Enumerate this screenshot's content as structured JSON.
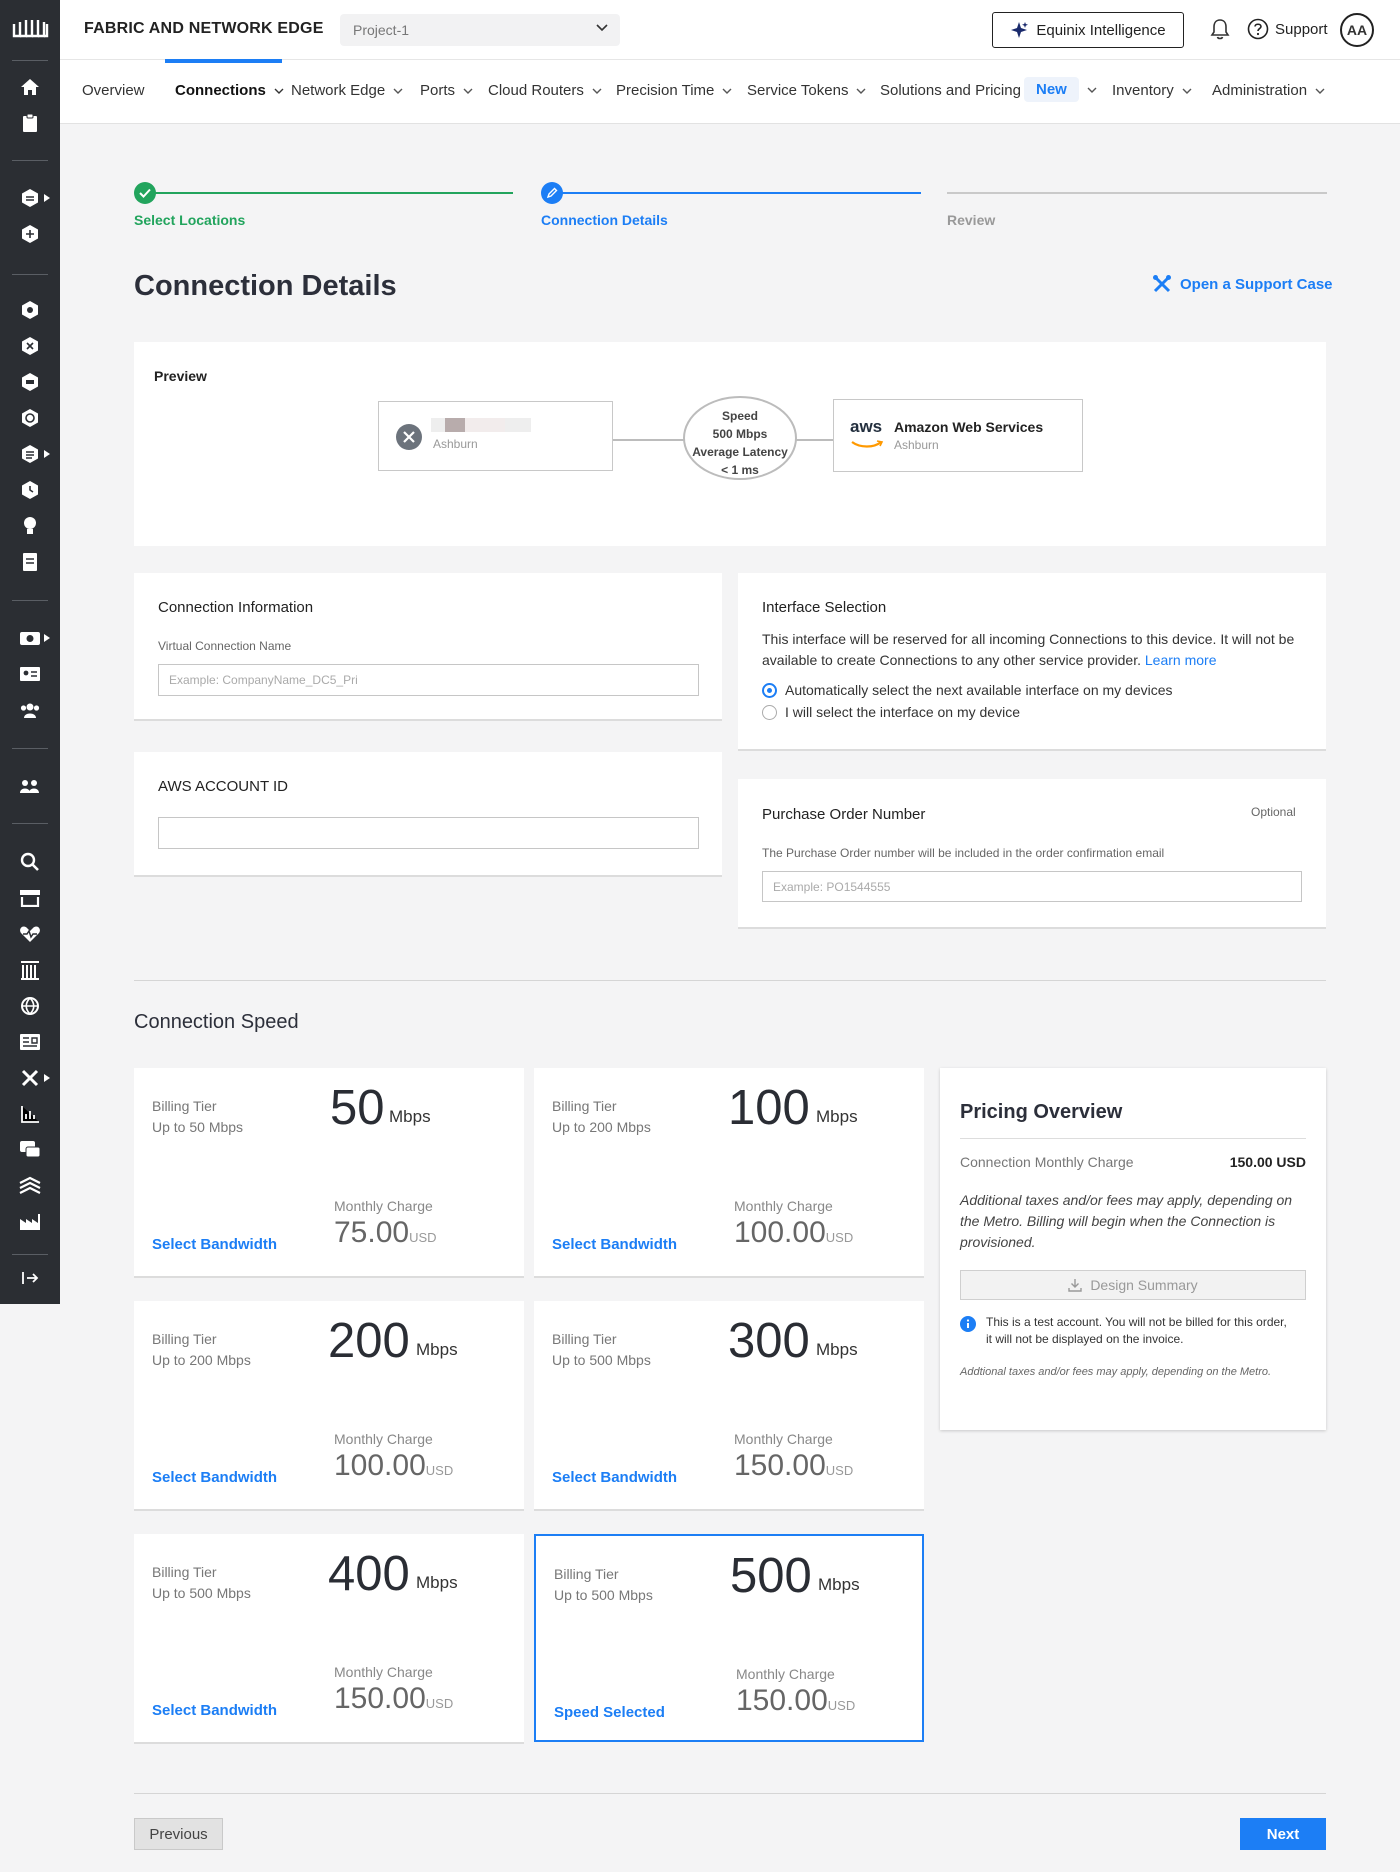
{
  "header": {
    "brand": "FABRIC AND NETWORK EDGE",
    "project": "Project-1",
    "intelligence_label": "Equinix Intelligence",
    "support_label": "Support",
    "avatar_initials": "AA"
  },
  "nav": {
    "items": [
      {
        "label": "Overview"
      },
      {
        "label": "Connections"
      },
      {
        "label": "Network Edge"
      },
      {
        "label": "Ports"
      },
      {
        "label": "Cloud Routers"
      },
      {
        "label": "Precision Time"
      },
      {
        "label": "Service Tokens"
      },
      {
        "label": "Solutions and Pricing"
      },
      {
        "label": "New"
      },
      {
        "label": "Inventory"
      },
      {
        "label": "Administration"
      }
    ]
  },
  "stepper": {
    "steps": [
      {
        "label": "Select Locations",
        "state": "complete"
      },
      {
        "label": "Connection Details",
        "state": "active"
      },
      {
        "label": "Review",
        "state": "pending"
      }
    ]
  },
  "page": {
    "title": "Connection Details",
    "support_case": "Open a Support Case"
  },
  "preview": {
    "title": "Preview",
    "source_location": "Ashburn",
    "speed_label": "Speed",
    "speed_value": "500 Mbps",
    "latency_label": "Average Latency",
    "latency_value": "< 1 ms",
    "dest_logo": "aws",
    "dest_name": "Amazon Web Services",
    "dest_location": "Ashburn"
  },
  "connection_info": {
    "title": "Connection Information",
    "name_label": "Virtual Connection Name",
    "name_placeholder": "Example: CompanyName_DC5_Pri"
  },
  "aws_account": {
    "title": "AWS ACCOUNT ID",
    "value": ""
  },
  "interface_selection": {
    "title": "Interface Selection",
    "description": "This interface will be reserved for all incoming Connections to this device. It will not be available to create Connections to any other service provider.",
    "learn_more": "Learn more",
    "option_auto": "Automatically select the next available interface on my devices",
    "option_manual": "I will select the interface on my device"
  },
  "purchase_order": {
    "title": "Purchase Order Number",
    "optional": "Optional",
    "hint": "The Purchase Order number will be included in the order confirmation email",
    "placeholder": "Example: PO1544555"
  },
  "speed_section": {
    "title": "Connection Speed",
    "billing_tier_label": "Billing Tier",
    "unit": "Mbps",
    "monthly_charge_label": "Monthly Charge",
    "currency": "USD",
    "tiers": [
      {
        "tier": "Up to 50 Mbps",
        "speed": "50",
        "charge": "75.00",
        "action": "Select Bandwidth"
      },
      {
        "tier": "Up to 200 Mbps",
        "speed": "100",
        "charge": "100.00",
        "action": "Select Bandwidth"
      },
      {
        "tier": "Up to 200 Mbps",
        "speed": "200",
        "charge": "100.00",
        "action": "Select Bandwidth"
      },
      {
        "tier": "Up to 500 Mbps",
        "speed": "300",
        "charge": "150.00",
        "action": "Select Bandwidth"
      },
      {
        "tier": "Up to 500 Mbps",
        "speed": "400",
        "charge": "150.00",
        "action": "Select Bandwidth"
      },
      {
        "tier": "Up to 500 Mbps",
        "speed": "500",
        "charge": "150.00",
        "action": "Speed Selected"
      }
    ]
  },
  "pricing": {
    "title": "Pricing Overview",
    "charge_label": "Connection Monthly Charge",
    "charge_value": "150.00 USD",
    "note": "Additional taxes and/or fees may apply, depending on the Metro. Billing will begin when the Connection is provisioned.",
    "design_summary": "Design Summary",
    "test_notice": "This is a test account. You will not be billed for this order, it will not be displayed on the invoice.",
    "footer_note": "Addtional taxes and/or fees may apply, depending on the Metro."
  },
  "footer": {
    "previous": "Previous",
    "next": "Next"
  },
  "colors": {
    "accent": "#1c7ef5",
    "success": "#22a45d",
    "sidebar": "#2b2e33"
  }
}
